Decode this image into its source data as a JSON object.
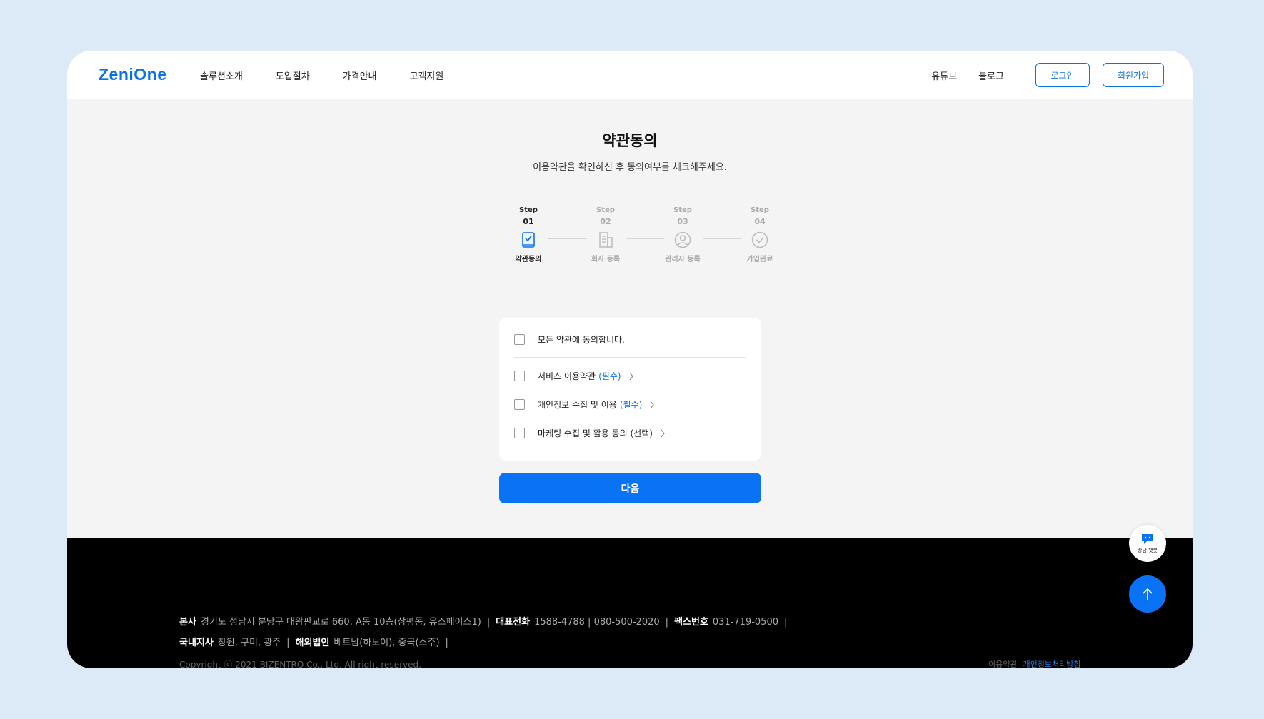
{
  "header": {
    "logo": "ZeniOne",
    "nav": [
      "솔루션소개",
      "도입절차",
      "가격안내",
      "고객지원"
    ],
    "links": [
      "유튜브",
      "블로그"
    ],
    "login_label": "로그인",
    "signup_label": "회원가입"
  },
  "page": {
    "title": "약관동의",
    "subtitle": "이용약관을 확인하신 후 동의여부를 체크해주세요."
  },
  "steps": [
    {
      "label": "Step",
      "num": "01",
      "name": "약관동의",
      "icon": "agreement-icon",
      "active": true
    },
    {
      "label": "Step",
      "num": "02",
      "name": "회사 등록",
      "icon": "building-icon",
      "active": false
    },
    {
      "label": "Step",
      "num": "03",
      "name": "관리자 등록",
      "icon": "user-icon",
      "active": false
    },
    {
      "label": "Step",
      "num": "04",
      "name": "가입완료",
      "icon": "check-circle-icon",
      "active": false
    }
  ],
  "terms": {
    "all": "모든 약관에 동의합니다.",
    "items": [
      {
        "text": "서비스 이용약관",
        "tag": "(필수)"
      },
      {
        "text": "개인정보 수집 및 이용",
        "tag": "(필수)"
      },
      {
        "text": "마케팅 수집 및 활용 동의 (선택)",
        "tag": ""
      }
    ]
  },
  "next_label": "다음",
  "footer": {
    "hq_label": "본사",
    "hq_value": "경기도 성남시 분당구 대왕판교로 660, A동 10층(삼평동, 유스페이스1)",
    "phone_label": "대표전화",
    "phone_value": "1588-4788 | 080-500-2020",
    "fax_label": "팩스번호",
    "fax_value": "031-719-0500",
    "domestic_label": "국내지사",
    "domestic_value": "창원, 구미, 광주",
    "overseas_label": "해외법인",
    "overseas_value": "베트남(하노이), 중국(소주)",
    "sep": "|",
    "copyright": "Copyright ⓒ 2021 BIZENTRO Co., Ltd. All right reserved.",
    "terms_link": "이용약관",
    "privacy_link": "개인정보처리방침"
  },
  "chat_label": "상담 챗봇",
  "colors": {
    "accent": "#0a72f5",
    "background": "#dce9f6",
    "footer": "#000000"
  }
}
